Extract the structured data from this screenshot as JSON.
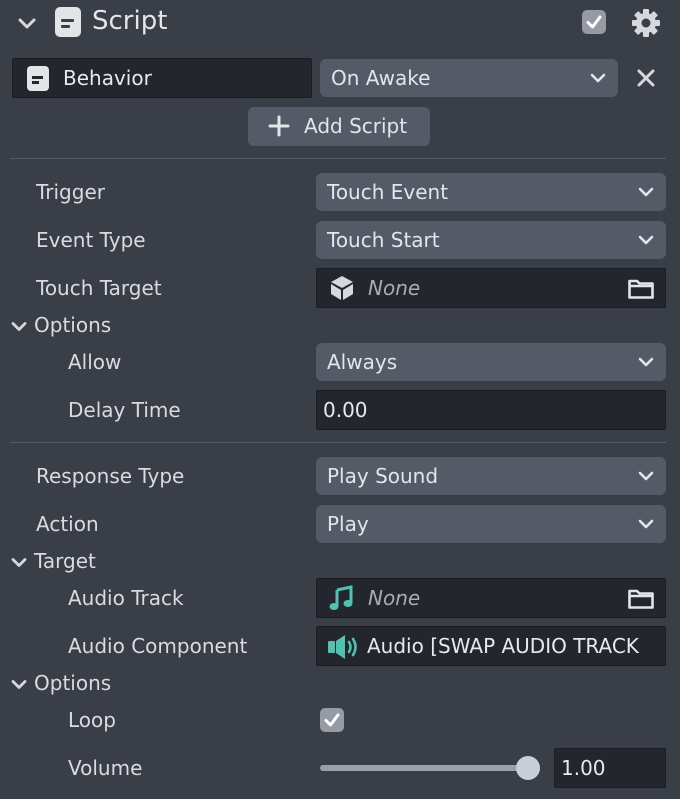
{
  "header": {
    "title": "Script"
  },
  "script_row": {
    "script_name": "Behavior",
    "event_value": "On Awake"
  },
  "add_script_label": "Add Script",
  "trigger": {
    "trigger_label": "Trigger",
    "trigger_value": "Touch Event",
    "event_type_label": "Event Type",
    "event_type_value": "Touch Start",
    "touch_target_label": "Touch Target",
    "touch_target_value": "None",
    "options_label": "Options",
    "allow_label": "Allow",
    "allow_value": "Always",
    "delay_label": "Delay Time",
    "delay_value": "0.00"
  },
  "response": {
    "response_type_label": "Response Type",
    "response_type_value": "Play Sound",
    "action_label": "Action",
    "action_value": "Play",
    "target_label": "Target",
    "audio_track_label": "Audio Track",
    "audio_track_value": "None",
    "audio_component_label": "Audio Component",
    "audio_component_value": "Audio [SWAP AUDIO TRACK",
    "options_label": "Options",
    "loop_label": "Loop",
    "loop_checked": true,
    "volume_label": "Volume",
    "volume_value": "1.00"
  },
  "colors": {
    "background": "#3a3e46",
    "dropdown": "#545b66",
    "field": "#23262c",
    "audio_accent": "#4fc3b0"
  },
  "icons": {
    "collapse": "chevron-down-icon",
    "script": "script-icon",
    "enabled": "checkbox-checked-icon",
    "settings": "gear-icon",
    "remove": "close-icon",
    "add": "plus-icon",
    "scene_object": "cube-icon",
    "folder": "folder-icon",
    "audio_track": "music-note-icon",
    "audio_component": "speaker-icon"
  }
}
